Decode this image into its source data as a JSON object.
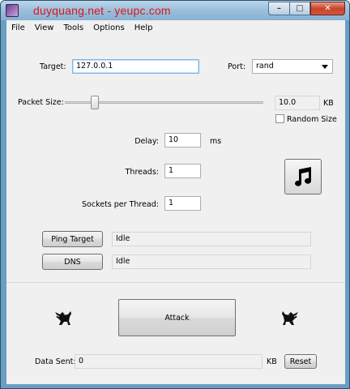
{
  "window": {
    "title": "duyquang.net - yeupc.com",
    "controls": {
      "minimize": "–",
      "maximize": "□",
      "close": "✕"
    }
  },
  "menu": [
    "File",
    "View",
    "Tools",
    "Options",
    "Help"
  ],
  "target": {
    "label": "Target:",
    "value": "127.0.0.1"
  },
  "port": {
    "label": "Port:",
    "value": "rand"
  },
  "packet_size": {
    "label": "Packet Size:",
    "value": "10.0",
    "unit": "KB",
    "slider_fraction": 0.15
  },
  "random_size": {
    "label": "Random Size",
    "checked": false
  },
  "delay": {
    "label": "Delay:",
    "value": "10",
    "unit": "ms"
  },
  "threads": {
    "label": "Threads:",
    "value": "1"
  },
  "sockets": {
    "label": "Sockets per Thread:",
    "value": "1"
  },
  "ping": {
    "button": "Ping Target",
    "status": "Idle"
  },
  "dns": {
    "button": "DNS",
    "status": "Idle"
  },
  "attack": {
    "button": "Attack"
  },
  "data_sent": {
    "label": "Data Sent:",
    "value": "0",
    "unit": "KB",
    "reset": "Reset"
  },
  "icons": {
    "music": "music-note-icon",
    "logo_left": "pegasus-icon",
    "logo_right": "pegasus-icon"
  },
  "colors": {
    "title_text": "#e0151b",
    "frame": "#6a9ec2",
    "client_bg": "#f0f0f0"
  }
}
